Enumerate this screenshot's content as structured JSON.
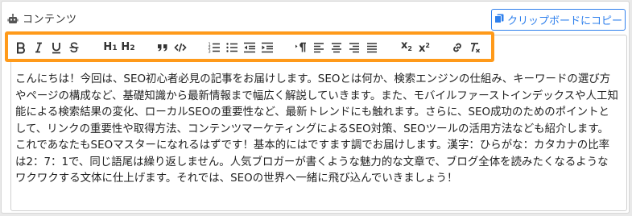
{
  "header": {
    "title": "コンテンツ",
    "icon": "robot-icon",
    "copy_button_label": "クリップボードにコピー",
    "copy_button_icon": "copy-icon"
  },
  "colors": {
    "accent": "#2f80ed",
    "highlight": "#ff9a1a"
  },
  "toolbar": {
    "buttons": [
      "bold",
      "italic",
      "underline",
      "strikethrough",
      "heading-1",
      "heading-2",
      "blockquote",
      "code",
      "ordered-list",
      "bullet-list",
      "outdent",
      "indent",
      "text-direction",
      "align-left",
      "align-center",
      "align-right",
      "align-justify",
      "subscript",
      "superscript",
      "link",
      "clear-formatting"
    ],
    "h1_label": "H1",
    "h2_label": "H2"
  },
  "content": {
    "text": "こんにちは！今回は、SEO初心者必見の記事をお届けします。SEOとは何か、検索エンジンの仕組み、キーワードの選び方やページの構成など、基礎知識から最新情報まで幅広く解説していきます。また、モバイルファーストインデックスや人工知能による検索結果の変化、ローカルSEOの重要性など、最新トレンドにも触れます。さらに、SEO成功のためのポイントとして、リンクの重要性や取得方法、コンテンツマーケティングによるSEO対策、SEOツールの活用方法なども紹介します。これであなたもSEOマスターになれるはずです！基本的にはですます調でお届けします。漢字：ひらがな：カタカナの比率は2：7：1で、同じ語尾は繰り返しません。人気ブロガーが書くような魅力的な文章で、ブログ全体を読みたくなるようなワクワクする文体に仕上げます。それでは、SEOの世界へ一緒に飛び込んでいきましょう！"
  }
}
